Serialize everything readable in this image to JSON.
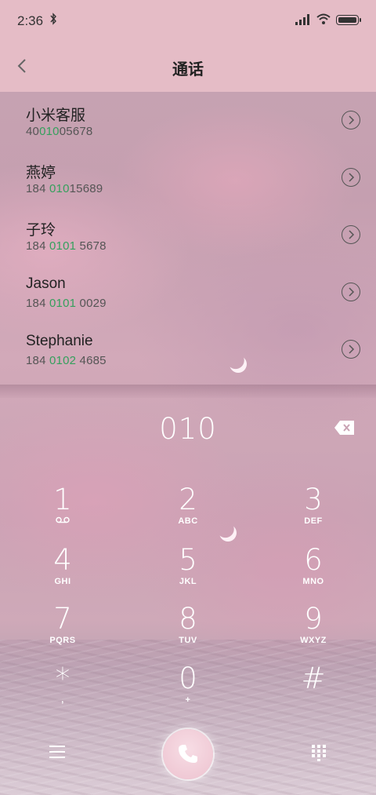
{
  "status_bar": {
    "time": "2:36",
    "bluetooth_icon": "bluetooth-icon",
    "signal_icon": "signal-icon",
    "wifi_icon": "wifi-icon",
    "battery_icon": "battery-icon"
  },
  "header": {
    "title": "通话",
    "back_icon": "chevron-left-icon"
  },
  "contacts": [
    {
      "name": "小米客服",
      "num_pre": "40",
      "num_hl": "010",
      "num_post": "05678"
    },
    {
      "name": "燕婷",
      "num_pre": "184 ",
      "num_hl": "010",
      "num_post": "15689"
    },
    {
      "name": "子玲",
      "num_pre": "184 ",
      "num_hl": "0101",
      "num_post": " 5678"
    },
    {
      "name": "Jason",
      "num_pre": "184 ",
      "num_hl": "0101",
      "num_post": " 0029"
    },
    {
      "name": "Stephanie",
      "num_pre": "184 ",
      "num_hl": "0102",
      "num_post": " 4685"
    }
  ],
  "dialer": {
    "input": "010",
    "keys": [
      {
        "digit": "1",
        "letters": "voicemail-icon"
      },
      {
        "digit": "2",
        "letters": "ABC"
      },
      {
        "digit": "3",
        "letters": "DEF"
      },
      {
        "digit": "4",
        "letters": "GHI"
      },
      {
        "digit": "5",
        "letters": "JKL"
      },
      {
        "digit": "6",
        "letters": "MNO"
      },
      {
        "digit": "7",
        "letters": "PQRS"
      },
      {
        "digit": "8",
        "letters": "TUV"
      },
      {
        "digit": "9",
        "letters": "WXYZ"
      },
      {
        "digit": "*",
        "letters": ","
      },
      {
        "digit": "0",
        "letters": "+"
      },
      {
        "digit": "#",
        "letters": ""
      }
    ]
  },
  "colors": {
    "header_bg": "#e5bcc6",
    "highlight": "#35a05d"
  }
}
